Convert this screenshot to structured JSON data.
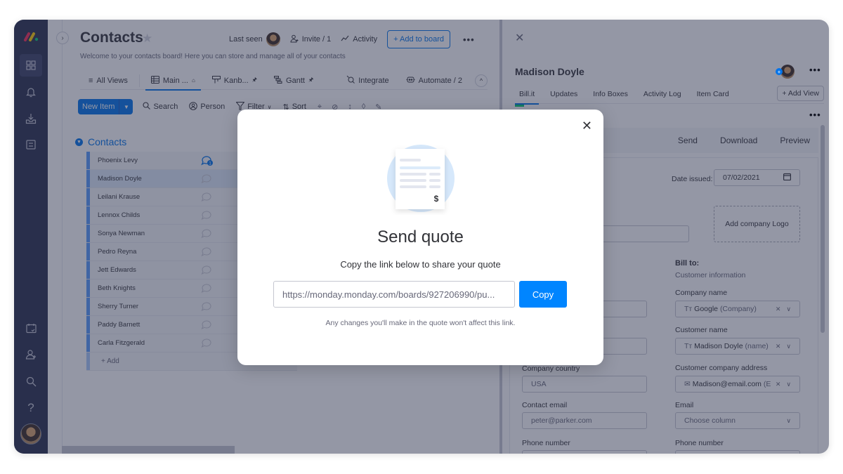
{
  "nav": {
    "logo": "monday-logo",
    "icons": [
      "workspaces-icon",
      "bell-icon",
      "inbox-icon",
      "my-work-icon",
      "calendar-check-icon",
      "invite-user-icon",
      "search-icon",
      "help-icon"
    ]
  },
  "board": {
    "title": "Contacts",
    "description": "Welcome to your contacts board! Here you can store and manage all of your contacts",
    "last_seen_label": "Last seen",
    "invite_label": "Invite / 1",
    "activity_label": "Activity",
    "add_to_board_label": "+ Add to board",
    "more_label": "•••",
    "views": [
      {
        "label": "All Views"
      },
      {
        "label": "Main ...",
        "pin": "⌂"
      },
      {
        "label": "Kanb...",
        "pin": "⧘"
      },
      {
        "label": "Gantt",
        "pin": "⧘"
      },
      {
        "label": "Integrate"
      },
      {
        "label": "Automate / 2"
      }
    ],
    "toolbar": {
      "new_item": "New Item",
      "search": "Search",
      "person": "Person",
      "filter": "Filter",
      "sort": "Sort"
    },
    "group": {
      "title": "Contacts",
      "items": [
        {
          "name": "Phoenix Levy",
          "updates": "1"
        },
        {
          "name": "Madison Doyle",
          "selected": true
        },
        {
          "name": "Leilani Krause"
        },
        {
          "name": "Lennox Childs"
        },
        {
          "name": "Sonya Newman"
        },
        {
          "name": "Pedro Reyna"
        },
        {
          "name": "Jett Edwards"
        },
        {
          "name": "Beth Knights"
        },
        {
          "name": "Sherry Turner"
        },
        {
          "name": "Paddy Barnett"
        },
        {
          "name": "Carla Fitzgerald"
        }
      ],
      "add_label": "+ Add"
    }
  },
  "panel": {
    "item_name": "Madison Doyle",
    "tabs": [
      "Bill.it",
      "Updates",
      "Info Boxes",
      "Activity Log",
      "Item Card"
    ],
    "add_view_label": "+ Add View",
    "actions": [
      "Send",
      "Download",
      "Preview"
    ],
    "date_issued_label": "Date issued:",
    "date_issued_value": "07/02/2021",
    "add_logo_label": "Add company Logo",
    "bill_to_title": "Bill to:",
    "bill_to_sub": "Customer information",
    "left_fields": [
      {
        "label": "Company country",
        "value": "USA"
      },
      {
        "label": "Contact email",
        "value": "peter@parker.com"
      },
      {
        "label": "Phone number",
        "value": ""
      }
    ],
    "right_fields": [
      {
        "label": "Company name",
        "value": "Google",
        "suffix": "(Company)",
        "icon": "Tт"
      },
      {
        "label": "Customer name",
        "value": "Madison Doyle",
        "suffix": "(name)",
        "icon": "Tт"
      },
      {
        "label": "Customer company address",
        "value": "Madison@email.com",
        "suffix": "(E",
        "icon": "✉"
      },
      {
        "label": "Email",
        "value": "Choose column"
      },
      {
        "label": "Phone number",
        "value": ""
      }
    ]
  },
  "modal": {
    "title": "Send quote",
    "subtitle": "Copy the link below to share your quote",
    "link_value": "https://monday.monday.com/boards/927206990/pu...",
    "copy_label": "Copy",
    "note": "Any changes you'll make in the quote won't affect this link."
  },
  "colors": {
    "primary": "#0073ea",
    "copy_button": "#0085ff",
    "nav_bg": "#292f4c"
  }
}
